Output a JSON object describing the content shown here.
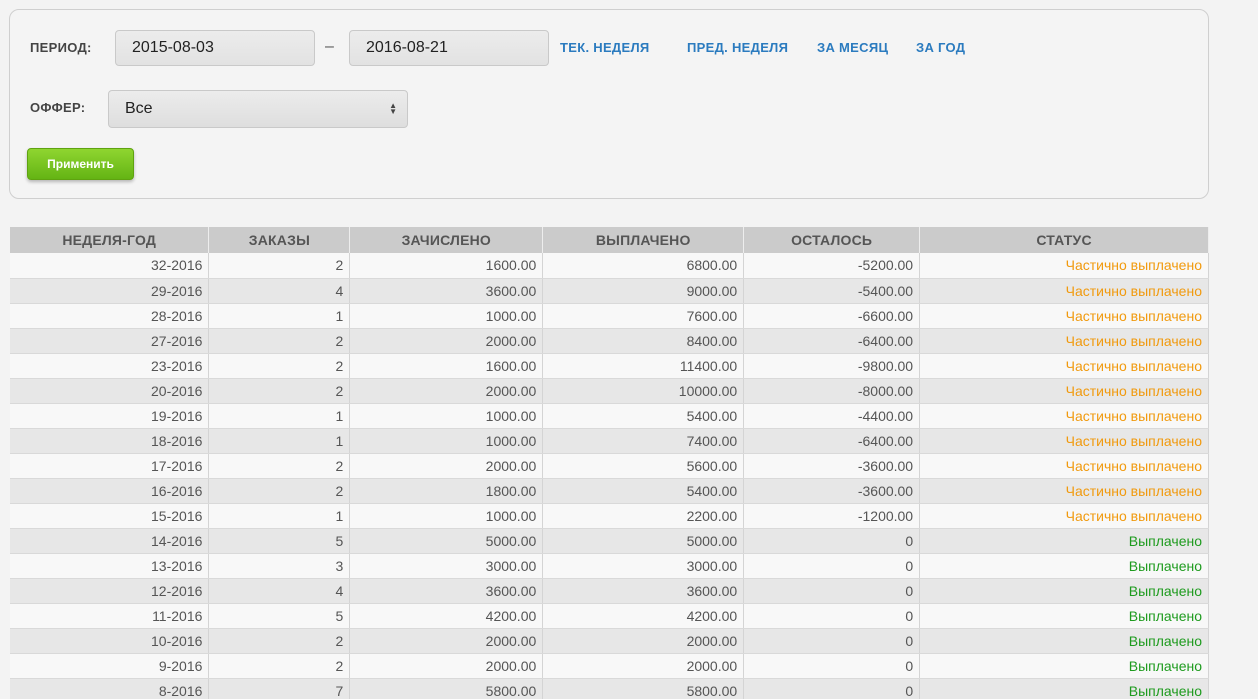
{
  "filters": {
    "period_label": "ПЕРИОД:",
    "date_from": "2015-08-03",
    "date_separator": "–",
    "date_to": "2016-08-21",
    "quick_links": [
      "ТЕК. НЕДЕЛЯ",
      "ПРЕД. НЕДЕЛЯ",
      "ЗА МЕСЯЦ",
      "ЗА ГОД"
    ],
    "offer_label": "ОФФЕР:",
    "offer_selected": "Все",
    "apply_label": "Применить"
  },
  "colors": {
    "link": "#2b7bbf",
    "apply_green": "#64b414",
    "status_partial": "#f19a0e",
    "status_paid": "#1e9b1e"
  },
  "table": {
    "headers": [
      "НЕДЕЛЯ-ГОД",
      "ЗАКАЗЫ",
      "ЗАЧИСЛЕНО",
      "ВЫПЛАЧЕНО",
      "ОСТАЛОСЬ",
      "СТАТУС"
    ],
    "rows": [
      [
        "32-2016",
        "2",
        "1600.00",
        "6800.00",
        "-5200.00",
        "Частично выплачено"
      ],
      [
        "29-2016",
        "4",
        "3600.00",
        "9000.00",
        "-5400.00",
        "Частично выплачено"
      ],
      [
        "28-2016",
        "1",
        "1000.00",
        "7600.00",
        "-6600.00",
        "Частично выплачено"
      ],
      [
        "27-2016",
        "2",
        "2000.00",
        "8400.00",
        "-6400.00",
        "Частично выплачено"
      ],
      [
        "23-2016",
        "2",
        "1600.00",
        "11400.00",
        "-9800.00",
        "Частично выплачено"
      ],
      [
        "20-2016",
        "2",
        "2000.00",
        "10000.00",
        "-8000.00",
        "Частично выплачено"
      ],
      [
        "19-2016",
        "1",
        "1000.00",
        "5400.00",
        "-4400.00",
        "Частично выплачено"
      ],
      [
        "18-2016",
        "1",
        "1000.00",
        "7400.00",
        "-6400.00",
        "Частично выплачено"
      ],
      [
        "17-2016",
        "2",
        "2000.00",
        "5600.00",
        "-3600.00",
        "Частично выплачено"
      ],
      [
        "16-2016",
        "2",
        "1800.00",
        "5400.00",
        "-3600.00",
        "Частично выплачено"
      ],
      [
        "15-2016",
        "1",
        "1000.00",
        "2200.00",
        "-1200.00",
        "Частично выплачено"
      ],
      [
        "14-2016",
        "5",
        "5000.00",
        "5000.00",
        "0",
        "Выплачено"
      ],
      [
        "13-2016",
        "3",
        "3000.00",
        "3000.00",
        "0",
        "Выплачено"
      ],
      [
        "12-2016",
        "4",
        "3600.00",
        "3600.00",
        "0",
        "Выплачено"
      ],
      [
        "11-2016",
        "5",
        "4200.00",
        "4200.00",
        "0",
        "Выплачено"
      ],
      [
        "10-2016",
        "2",
        "2000.00",
        "2000.00",
        "0",
        "Выплачено"
      ],
      [
        "9-2016",
        "2",
        "2000.00",
        "2000.00",
        "0",
        "Выплачено"
      ],
      [
        "8-2016",
        "7",
        "5800.00",
        "5800.00",
        "0",
        "Выплачено"
      ]
    ]
  }
}
